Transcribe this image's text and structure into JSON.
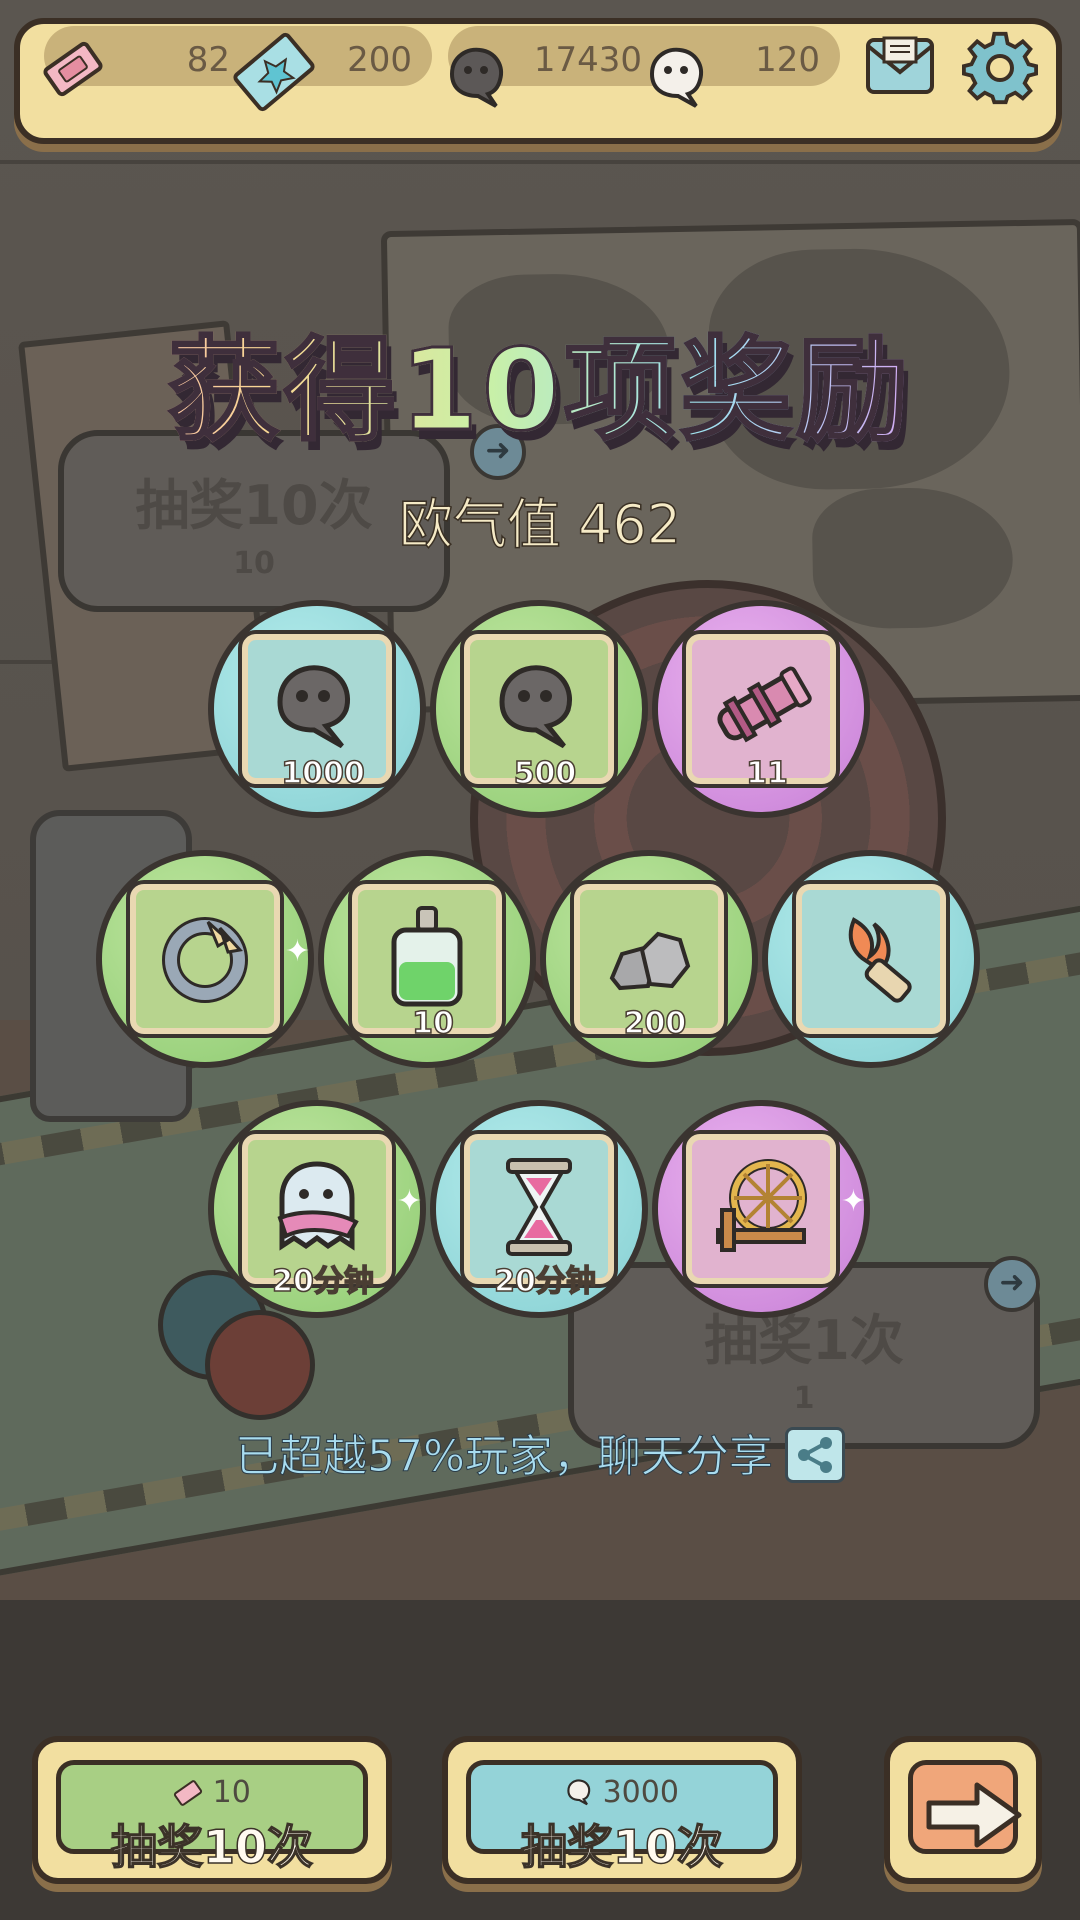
{
  "top_bar": {
    "tickets": "82",
    "dimension_tickets": "200",
    "souls": "17430",
    "white_souls": "120"
  },
  "background": {
    "draw10_label": "抽奖10次",
    "draw10_cost": "10",
    "draw1_label": "抽奖1次",
    "draw1_cost": "1"
  },
  "reward_panel": {
    "title": "获得10项奖励",
    "luck_label": "欧气值 462",
    "share_text": "已超越57%玩家，聊天分享",
    "rewards": [
      {
        "icon": "soul-icon",
        "quantity": "1000",
        "rarity": "teal"
      },
      {
        "icon": "soul-icon",
        "quantity": "500",
        "rarity": "green"
      },
      {
        "icon": "cannon-icon",
        "quantity": "11",
        "rarity": "purple"
      },
      {
        "icon": "claw-ring-icon",
        "quantity": "",
        "rarity": "green"
      },
      {
        "icon": "potion-bottle-icon",
        "quantity": "10",
        "rarity": "green"
      },
      {
        "icon": "stone-ore-icon",
        "quantity": "200",
        "rarity": "green"
      },
      {
        "icon": "flame-scroll-icon",
        "quantity": "",
        "rarity": "teal"
      },
      {
        "icon": "ghost-cloak-icon",
        "quantity": "20分钟",
        "rarity": "green"
      },
      {
        "icon": "hourglass-icon",
        "quantity": "20分钟",
        "rarity": "teal"
      },
      {
        "icon": "spinning-wheel-icon",
        "quantity": "",
        "rarity": "purple"
      }
    ]
  },
  "buttons": {
    "ticket_draw": {
      "cost": "10",
      "label": "抽奖10次"
    },
    "soul_draw": {
      "cost": "3000",
      "label": "抽奖10次"
    }
  },
  "colors": {
    "teal": "#86cfd2",
    "green": "#8fcb72",
    "purple": "#c77fd6",
    "ticket_button": "#a8cf84",
    "soul_button": "#94d3d8",
    "next_button": "#f0a67a"
  }
}
